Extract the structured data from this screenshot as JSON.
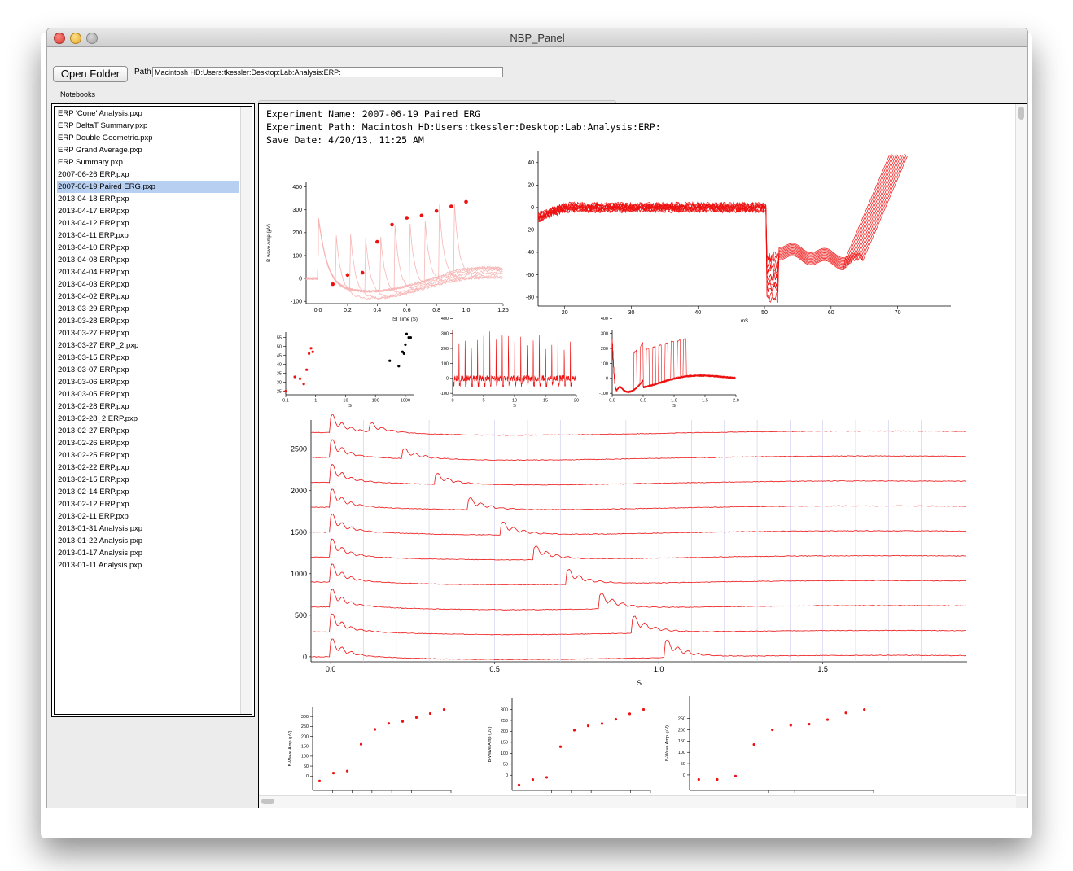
{
  "window": {
    "title": "NBP_Panel"
  },
  "toolbar": {
    "open_folder_label": "Open Folder",
    "path_label": "Path",
    "path_value": "Macintosh HD:Users:tkessler:Desktop:Lab:Analysis:ERP:"
  },
  "notebooks": {
    "label": "Notebooks",
    "selected_index": 6,
    "items": [
      "ERP 'Cone' Analysis.pxp",
      "ERP DeltaT Summary.pxp",
      "ERP Double Geometric.pxp",
      "ERP Grand Average.pxp",
      "ERP Summary.pxp",
      "2007-06-26 ERP.pxp",
      "2007-06-19 Paired ERG.pxp",
      "2013-04-18 ERP.pxp",
      "2013-04-17 ERP.pxp",
      "2013-04-12 ERP.pxp",
      "2013-04-11 ERP.pxp",
      "2013-04-10 ERP.pxp",
      "2013-04-08 ERP.pxp",
      "2013-04-04 ERP.pxp",
      "2013-04-03 ERP.pxp",
      "2013-04-02 ERP.pxp",
      "2013-03-29 ERP.pxp",
      "2013-03-28 ERP.pxp",
      "2013-03-27 ERP.pxp",
      "2013-03-27 ERP_2.pxp",
      "2013-03-15 ERP.pxp",
      "2013-03-07 ERP.pxp",
      "2013-03-06 ERP.pxp",
      "2013-03-05 ERP.pxp",
      "2013-02-28 ERP.pxp",
      "2013-02-28_2 ERP.pxp",
      "2013-02-27 ERP.pxp",
      "2013-02-26 ERP.pxp",
      "2013-02-25 ERP.pxp",
      "2013-02-22 ERP.pxp",
      "2013-02-15 ERP.pxp",
      "2013-02-14 ERP.pxp",
      "2013-02-12 ERP.pxp",
      "2013-02-11 ERP.pxp",
      "2013-01-31 Analysis.pxp",
      "2013-01-22 Analysis.pxp",
      "2013-01-17 Analysis.pxp",
      "2013-01-11 Analysis.pxp"
    ]
  },
  "notebook": {
    "experiment_name": "Experiment Name: 2007-06-19 Paired ERG",
    "experiment_path": "Experiment Path: Macintosh HD:Users:tkessler:Desktop:Lab:Analysis:ERP:",
    "save_date": "Save Date: 4/20/13, 11:25 AM"
  },
  "colors": {
    "trace": "#ee1111",
    "trace_light": "#f7b7b7",
    "selection": "#b7d0f2",
    "grid": "#c8c8ec"
  },
  "chart_data": [
    {
      "type": "scatter",
      "ylabel": "B-wave Amp (µV)",
      "xlabel": "ISI Time (S)",
      "xlim": [
        -0.08,
        1.25
      ],
      "ylim": [
        -110,
        420
      ],
      "xticks": [
        "0.0",
        "0.2",
        "0.4",
        "0.6",
        "0.8",
        "1.0",
        "1.25"
      ],
      "yticks": [
        "400",
        "300",
        "200",
        "100",
        "0",
        "-100"
      ],
      "x": [
        0.1,
        0.2,
        0.3,
        0.4,
        0.5,
        0.6,
        0.7,
        0.8,
        0.9,
        1.0
      ],
      "y": [
        -25,
        15,
        25,
        160,
        235,
        265,
        275,
        295,
        315,
        335
      ]
    },
    {
      "type": "line",
      "xlabel": "mS",
      "xlim": [
        16,
        78
      ],
      "ylim": [
        -88,
        50
      ],
      "xticks": [
        "20",
        "30",
        "40",
        "50",
        "60",
        "70"
      ],
      "yticks": [
        "40",
        "20",
        "0",
        "-20",
        "-40",
        "-60",
        "-80"
      ]
    },
    {
      "type": "scatter",
      "xlabel": "S",
      "xscale": "log",
      "xticks": [
        "0.1",
        "1",
        "10",
        "100",
        "1000"
      ],
      "yticks": [
        "55",
        "50",
        "45",
        "40",
        "35",
        "30",
        "25"
      ],
      "series": [
        {
          "x": [
            0.1,
            0.2,
            0.3,
            0.4,
            0.5,
            0.6,
            0.7,
            0.8
          ],
          "y": [
            25,
            33,
            32,
            29,
            37,
            46,
            49,
            47
          ]
        },
        {
          "x": [
            300,
            600,
            800,
            900,
            1000,
            1100,
            1300,
            1500
          ],
          "y": [
            42,
            39,
            47,
            46,
            51,
            57,
            55,
            55
          ]
        }
      ]
    },
    {
      "type": "line",
      "xlabel": "S",
      "xticks": [
        "0",
        "5",
        "10",
        "15",
        "20"
      ],
      "yticks": [
        "400",
        "300",
        "200",
        "100",
        "0",
        "-100"
      ]
    },
    {
      "type": "line",
      "xlabel": "S",
      "xticks": [
        "0.0",
        "0.5",
        "1.0",
        "1.5",
        "2.0"
      ],
      "yticks": [
        "400",
        "300",
        "200",
        "100",
        "0",
        "-100"
      ]
    },
    {
      "type": "line",
      "xlabel": "S",
      "xlim": [
        -0.06,
        1.94
      ],
      "ylim": [
        -60,
        2850
      ],
      "xticks": [
        "0.0",
        "0.5",
        "1.0",
        "1.5"
      ],
      "yticks": [
        "2500",
        "2000",
        "1500",
        "1000",
        "500",
        "0"
      ],
      "trace_offsets": [
        2700,
        2400,
        2100,
        1800,
        1500,
        1200,
        900,
        600,
        300,
        0
      ],
      "second_flash_times": [
        0.12,
        0.22,
        0.32,
        0.42,
        0.52,
        0.62,
        0.72,
        0.82,
        0.92,
        1.02
      ]
    },
    {
      "type": "scatter",
      "ylabel": "B-Wave Amp (µV)",
      "yticks": [
        "300",
        "250",
        "200",
        "150",
        "100",
        "50",
        "0"
      ],
      "x": [
        1,
        2,
        3,
        4,
        5,
        6,
        7,
        8,
        9,
        10
      ],
      "y": [
        -25,
        15,
        25,
        160,
        235,
        265,
        275,
        295,
        315,
        335
      ]
    },
    {
      "type": "scatter",
      "ylabel": "B-Wave Amp (µV)",
      "yticks": [
        "300",
        "250",
        "200",
        "150",
        "100",
        "50",
        "0"
      ],
      "x": [
        1,
        2,
        3,
        4,
        5,
        6,
        7,
        8,
        9,
        10
      ],
      "y": [
        -45,
        -20,
        -10,
        130,
        205,
        225,
        235,
        255,
        280,
        300
      ]
    },
    {
      "type": "scatter",
      "ylabel": "B-Wave Amp (µV)",
      "yticks": [
        "250",
        "200",
        "150",
        "100",
        "50",
        "0"
      ],
      "x": [
        1,
        2,
        3,
        4,
        5,
        6,
        7,
        8,
        9,
        10
      ],
      "y": [
        -20,
        -20,
        -5,
        135,
        200,
        220,
        225,
        245,
        275,
        290
      ]
    }
  ]
}
